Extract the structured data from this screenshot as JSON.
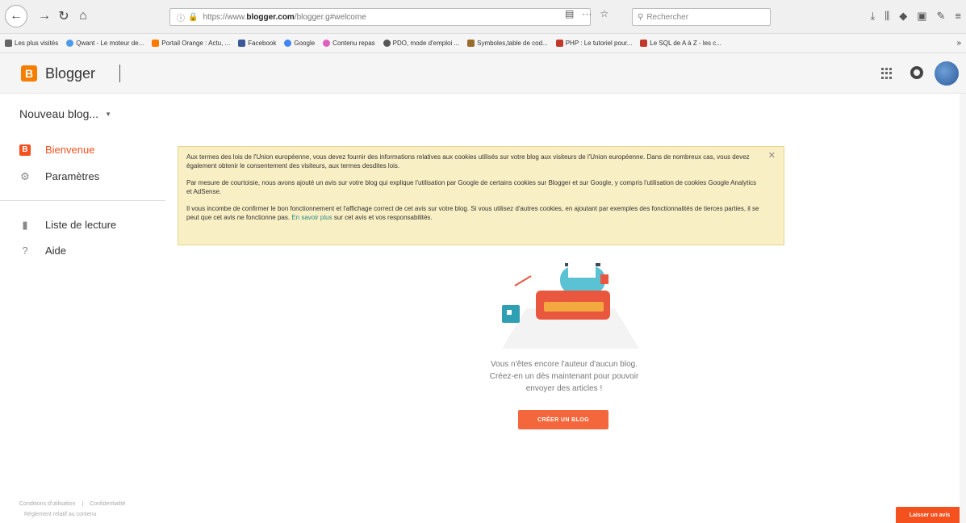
{
  "browser": {
    "url_prefix": "https://www.",
    "url_host": "blogger.com",
    "url_path": "/blogger.g#welcome",
    "search_placeholder": "Rechercher",
    "bookmarks": [
      {
        "label": "Les plus visités",
        "color": "#666666"
      },
      {
        "label": "Qwant - Le moteur de...",
        "color": "#4c9be8"
      },
      {
        "label": "Portail Orange : Actu, ...",
        "color": "#ff7900"
      },
      {
        "label": "Facebook",
        "color": "#3b5998"
      },
      {
        "label": "Google",
        "color": "#4285f4"
      },
      {
        "label": "Contenu repas",
        "color": "#e060c0"
      },
      {
        "label": "PDO, mode d'emploi ...",
        "color": "#555555"
      },
      {
        "label": "Symboles,table de cod...",
        "color": "#9a6b2a"
      },
      {
        "label": "PHP : Le tutoriel pour...",
        "color": "#c0392b"
      },
      {
        "label": "Le SQL de A à Z - les c...",
        "color": "#c0392b"
      }
    ]
  },
  "header": {
    "logo_letter": "B",
    "brand": "Blogger"
  },
  "sidebar": {
    "blog_select": "Nouveau blog...",
    "items": [
      {
        "label": "Bienvenue",
        "icon": "blogger-icon"
      },
      {
        "label": "Paramètres",
        "icon": "gear-icon"
      },
      {
        "label": "Liste de lecture",
        "icon": "bookmark-icon"
      },
      {
        "label": "Aide",
        "icon": "help-icon"
      }
    ],
    "footer": {
      "terms": "Conditions d'utilisation",
      "privacy": "Confidentialité",
      "content_policy": "Règlement relatif au contenu"
    }
  },
  "notice": {
    "p1": "Aux termes des lois de l'Union européenne, vous devez fournir des informations relatives aux cookies utilisés sur votre blog aux visiteurs de l'Union européenne. Dans de nombreux cas, vous devez également obtenir le consentement des visiteurs, aux termes desdites lois.",
    "p2": "Par mesure de courtoisie, nous avons ajouté un avis sur votre blog qui explique l'utilisation par Google de certains cookies sur Blogger et sur Google, y compris l'utilisation de cookies Google Analytics et AdSense.",
    "p3_before": "Il vous incombe de confirmer le bon fonctionnement et l'affichage correct de cet avis sur votre blog. Si vous utilisez d'autres cookies, en ajoutant par exemples des fonctionnalités de tierces parties, il se peut que cet avis ne fonctionne pas.",
    "p3_link": "En savoir plus",
    "p3_after": "sur cet avis et vos responsabilités."
  },
  "empty_state": {
    "line1": "Vous n'êtes encore l'auteur d'aucun blog.",
    "line2": "Créez-en un dès maintenant pour pouvoir",
    "line3": "envoyer des articles !",
    "button": "CRÉER UN BLOG"
  },
  "feedback_button": "Laisser un avis",
  "colors": {
    "accent": "#f4511e",
    "notice_bg": "#f9efc4",
    "link": "#2a8a86"
  }
}
